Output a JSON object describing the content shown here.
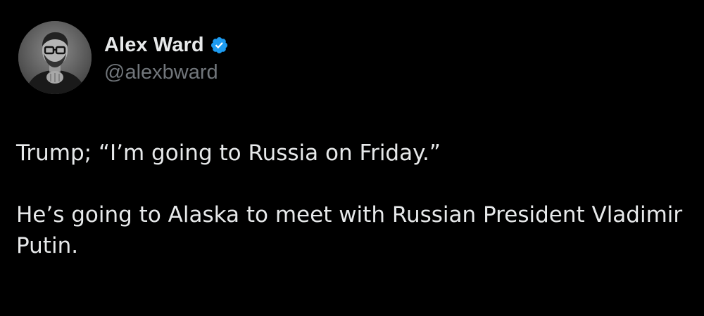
{
  "author": {
    "display_name": "Alex Ward",
    "handle": "@alexbward",
    "verified": true,
    "avatar_icon": "profile-photo",
    "badge_icon": "verified-check-icon"
  },
  "tweet": {
    "paragraphs": [
      "Trump; “I’m going to Russia on Friday.”",
      "He’s going to Alaska to meet with Russian President Vladimir Putin."
    ]
  },
  "colors": {
    "background": "#000000",
    "text_primary": "#e7e9ea",
    "text_secondary": "#71767b",
    "verified_blue": "#1d9bf0"
  }
}
